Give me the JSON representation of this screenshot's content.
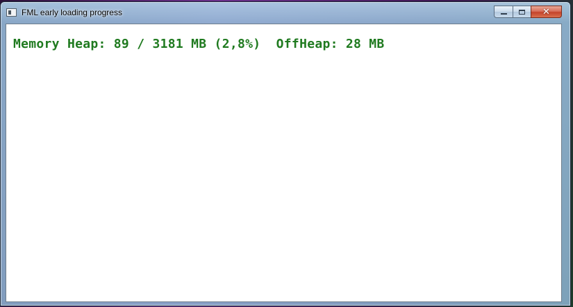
{
  "window": {
    "title": "FML early loading progress",
    "icon": "app-window-icon",
    "controls": {
      "minimize_icon": "minimize-icon",
      "maximize_icon": "maximize-icon",
      "close_icon": "close-icon",
      "close_glyph": "✕"
    }
  },
  "content": {
    "memory_line": "Memory Heap: 89 / 3181 MB (2,8%)  OffHeap: 28 MB",
    "text_color": "#1f7a1f"
  }
}
